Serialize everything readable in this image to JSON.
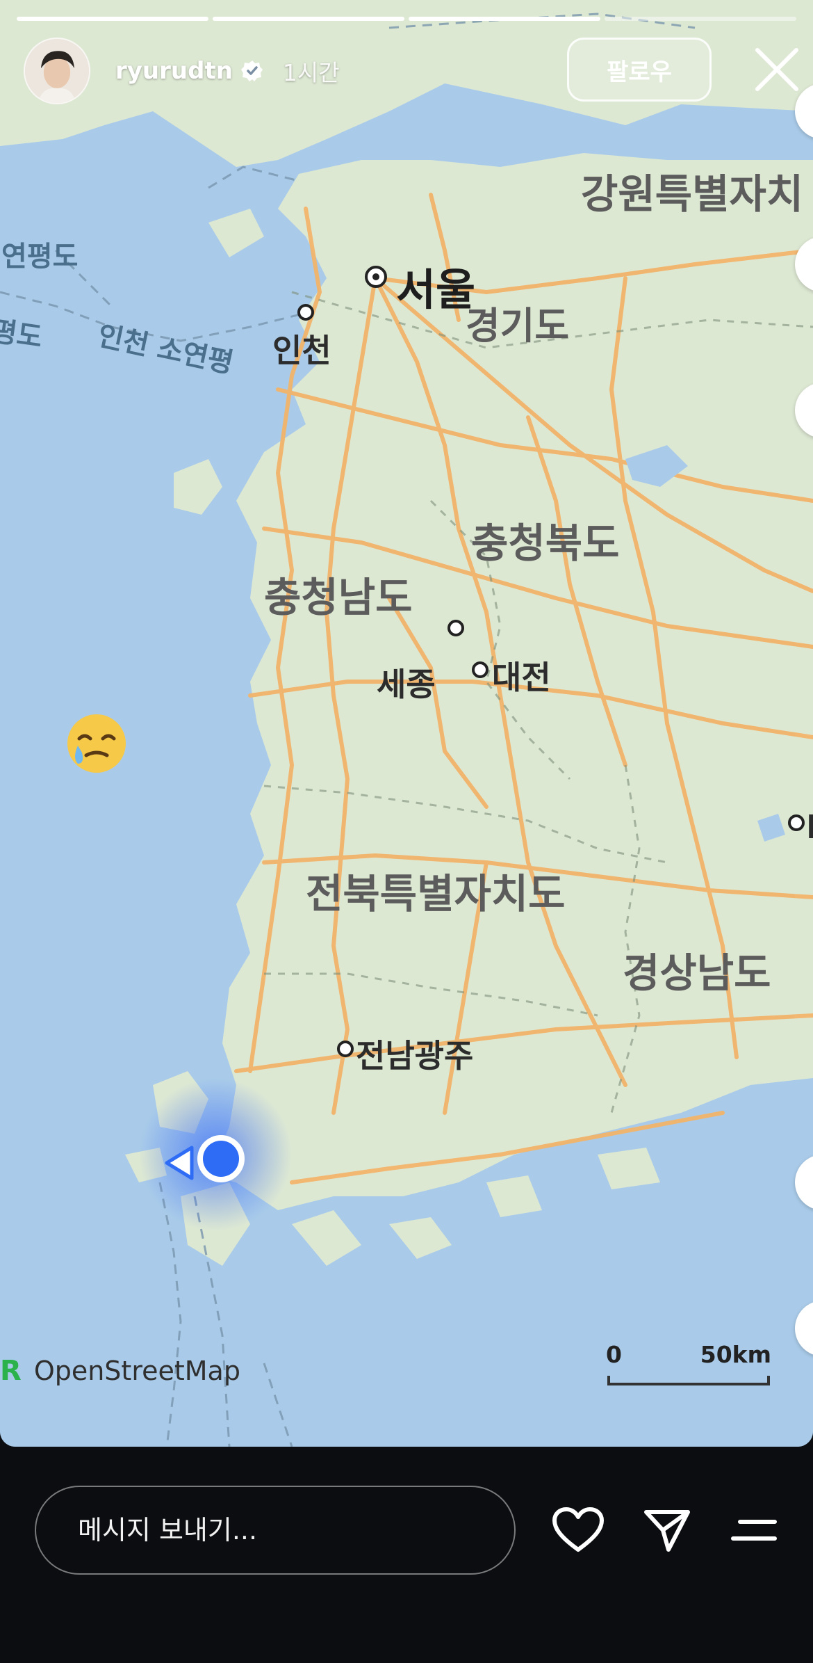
{
  "header": {
    "username": "ryurudtn",
    "time": "1시간",
    "follow_label": "팔로우"
  },
  "map": {
    "labels": {
      "gangwon": "강원특별자치",
      "gyeonggi": "경기도",
      "seoul": "서울",
      "incheon": "인천",
      "yeonpyeong": "연평도",
      "yeonpyeong2": "평도",
      "soyeonpyeong": "인천 소연평",
      "chungbuk": "충청북도",
      "chungnam": "충청남도",
      "sejong": "세종",
      "daejeon": "대전",
      "jeonbuk": "전북특별자치도",
      "gyeongnam": "경상남도",
      "gwangju": "전남광주",
      "edge": "D"
    },
    "attribution_prefix": "R",
    "attribution": "OpenStreetMap",
    "scale_start": "0",
    "scale_end": "50km"
  },
  "sticker": {
    "emoji": "face-holding-back-tears"
  },
  "footer": {
    "message_placeholder": "메시지 보내기..."
  },
  "colors": {
    "sea": "#a9cbe9",
    "land": "#dde8d3",
    "road": "#f2b46b",
    "location": "#2f6cf5",
    "bottom_bar": "#0b0d10"
  }
}
